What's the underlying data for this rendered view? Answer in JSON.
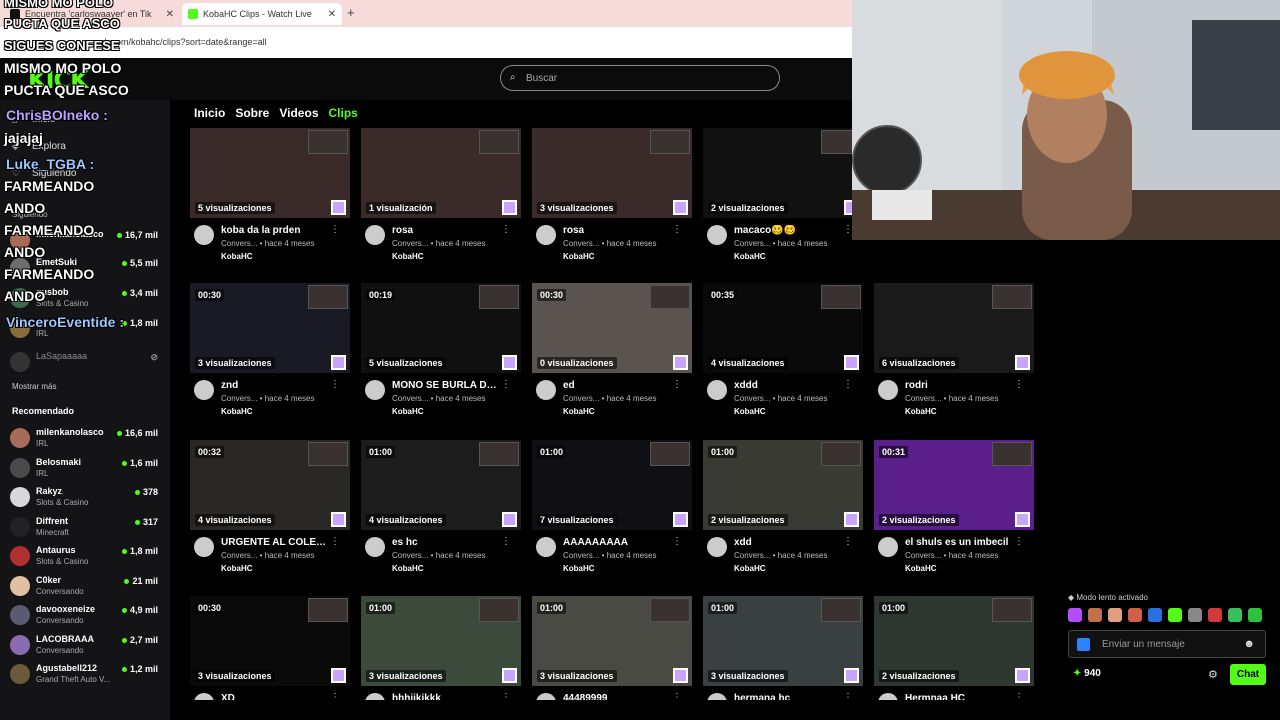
{
  "browser": {
    "tabs": [
      {
        "label": "Encuentra 'carloswaayer' en Tik",
        "active": false
      },
      {
        "label": "KobaHC Clips - Watch Live",
        "active": true
      }
    ],
    "url": "ck.com/kobahc/clips?sort=date&range=all"
  },
  "header": {
    "logo": "KICK",
    "search_placeholder": "Buscar"
  },
  "sidebar": {
    "nav": [
      {
        "label": "Inicio",
        "icon": "home-icon"
      },
      {
        "label": "Explora",
        "icon": "compass-icon"
      },
      {
        "label": "Siguiendo",
        "icon": "heart-icon"
      }
    ],
    "following_header": "Siguiendo",
    "following": [
      {
        "name": "milenkanolasco",
        "category": "",
        "viewers": "16,7 mil"
      },
      {
        "name": "EmetSuki",
        "category": "",
        "viewers": "5,5 mil"
      },
      {
        "name": "gusbob",
        "category": "Slots & Casino",
        "viewers": "3,4 mil"
      },
      {
        "name": "",
        "category": "IRL",
        "viewers": "1,8 mil"
      },
      {
        "name": "LaSapaaaaa",
        "category": "",
        "viewers": ""
      }
    ],
    "show_more": "Mostrar más",
    "recommended_header": "Recomendado",
    "recommended": [
      {
        "name": "milenkanolasco",
        "category": "IRL",
        "viewers": "16,6 mil"
      },
      {
        "name": "Belosmaki",
        "category": "IRL",
        "viewers": "1,6 mil"
      },
      {
        "name": "Rakyz",
        "category": "Slots & Casino",
        "viewers": "378"
      },
      {
        "name": "Diffrent",
        "category": "Minecraft",
        "viewers": "317"
      },
      {
        "name": "Antaurus",
        "category": "Slots & Casino",
        "viewers": "1,8 mil"
      },
      {
        "name": "C0ker",
        "category": "Conversando",
        "viewers": "21 mil"
      },
      {
        "name": "davooxeneize",
        "category": "Conversando",
        "viewers": "4,9 mil"
      },
      {
        "name": "LACOBRAAA",
        "category": "Conversando",
        "viewers": "2,7 mil"
      },
      {
        "name": "Agustabell212",
        "category": "Grand Theft Auto V...",
        "viewers": "1,2 mil"
      }
    ]
  },
  "overlay": {
    "lines": [
      "MISMO MO POLO",
      "PUCTA QUE ASCO",
      "SIGUES CONFESE",
      "MISMO MO POLO",
      "PUCTA QUE ASCO",
      "ChrisBOIneko :",
      "jajajaj",
      "Luke_TGBA :",
      "FARMEANDO",
      "ANDO",
      "FARMEANDO",
      "ANDO",
      "FARMEANDO",
      "ANDO",
      "VinceroEventide :"
    ]
  },
  "channel_tabs": [
    "Inicio",
    "Sobre",
    "Videos",
    "Clips"
  ],
  "clips": [
    {
      "title": "koba da la prden",
      "duration": "",
      "views": "5 visualizaciones",
      "meta": "Convers... • hace 4 meses",
      "channel": "KobaHC",
      "thumb": "#3a2a2a"
    },
    {
      "title": "rosa",
      "duration": "",
      "views": "1 visualización",
      "meta": "Convers... • hace 4 meses",
      "channel": "KobaHC",
      "thumb": "#3a2a2a"
    },
    {
      "title": "rosa",
      "duration": "",
      "views": "3 visualizaciones",
      "meta": "Convers... • hace 4 meses",
      "channel": "KobaHC",
      "thumb": "#3a2a2a"
    },
    {
      "title": "macaco🥴🥴",
      "duration": "",
      "views": "2 visualizaciones",
      "meta": "Convers... • hace 4 meses",
      "channel": "KobaHC",
      "thumb": "#111"
    },
    {
      "title": "znd",
      "duration": "00:30",
      "views": "3 visualizaciones",
      "meta": "Convers... • hace 4 meses",
      "channel": "KobaHC",
      "thumb": "#1a1a24"
    },
    {
      "title": "MONO SE BURLA DE ...",
      "duration": "00:19",
      "views": "5 visualizaciones",
      "meta": "Convers... • hace 4 meses",
      "channel": "KobaHC",
      "thumb": "#101010"
    },
    {
      "title": "ed",
      "duration": "00:30",
      "views": "0 visualizaciones",
      "meta": "Convers... • hace 4 meses",
      "channel": "KobaHC",
      "thumb": "#5a5450"
    },
    {
      "title": "xddd",
      "duration": "00:35",
      "views": "4 visualizaciones",
      "meta": "Convers... • hace 4 meses",
      "channel": "KobaHC",
      "thumb": "#0a0a0a"
    },
    {
      "title": "rodri",
      "duration": "",
      "views": "6 visualizaciones",
      "meta": "Convers... • hace 4 meses",
      "channel": "KobaHC",
      "thumb": "#1a1a1a"
    },
    {
      "title": "URGENTE AL COLEG...",
      "duration": "00:32",
      "views": "4 visualizaciones",
      "meta": "Convers... • hace 4 meses",
      "channel": "KobaHC",
      "thumb": "#2a2824"
    },
    {
      "title": "es hc",
      "duration": "01:00",
      "views": "4 visualizaciones",
      "meta": "Convers... • hace 4 meses",
      "channel": "KobaHC",
      "thumb": "#1c1c1c"
    },
    {
      "title": "AAAAAAAAA",
      "duration": "01:00",
      "views": "7 visualizaciones",
      "meta": "Convers... • hace 4 meses",
      "channel": "KobaHC",
      "thumb": "#101014"
    },
    {
      "title": "xdd",
      "duration": "01:00",
      "views": "2 visualizaciones",
      "meta": "Convers... • hace 4 meses",
      "channel": "KobaHC",
      "thumb": "#3a3a34"
    },
    {
      "title": "el shuls es un imbecil",
      "duration": "00:31",
      "views": "2 visualizaciones",
      "meta": "Convers... • hace 4 meses",
      "channel": "KobaHC",
      "thumb": "#5a1f8a"
    },
    {
      "title": "XD",
      "duration": "00:30",
      "views": "3 visualizaciones",
      "meta": "Convers... • hace 4 meses",
      "channel": "KobaHC",
      "thumb": "#0a0a0a"
    },
    {
      "title": "hhhjjkjkkk",
      "duration": "01:00",
      "views": "3 visualizaciones",
      "meta": "IRL • hace 4 meses",
      "channel": "KobaHC",
      "thumb": "#3c4a3c"
    },
    {
      "title": "44489999",
      "duration": "01:00",
      "views": "3 visualizaciones",
      "meta": "IRL • hace 4 meses",
      "channel": "KobaHC",
      "thumb": "#4a4a44"
    },
    {
      "title": "hermana hc",
      "duration": "01:00",
      "views": "3 visualizaciones",
      "meta": "IRL • hace 4 meses",
      "channel": "KobaHC",
      "thumb": "#3a4040"
    },
    {
      "title": "Hermnaa HC",
      "duration": "01:00",
      "views": "2 visualizaciones",
      "meta": "IRL • hace 4 meses",
      "channel": "KobaHC",
      "thumb": "#2e3830"
    }
  ],
  "chat": {
    "slow_mode": "Modo lento activado",
    "input_placeholder": "Enviar un mensaje",
    "points": "940",
    "send_label": "Chat",
    "accent": "#53fc18"
  }
}
